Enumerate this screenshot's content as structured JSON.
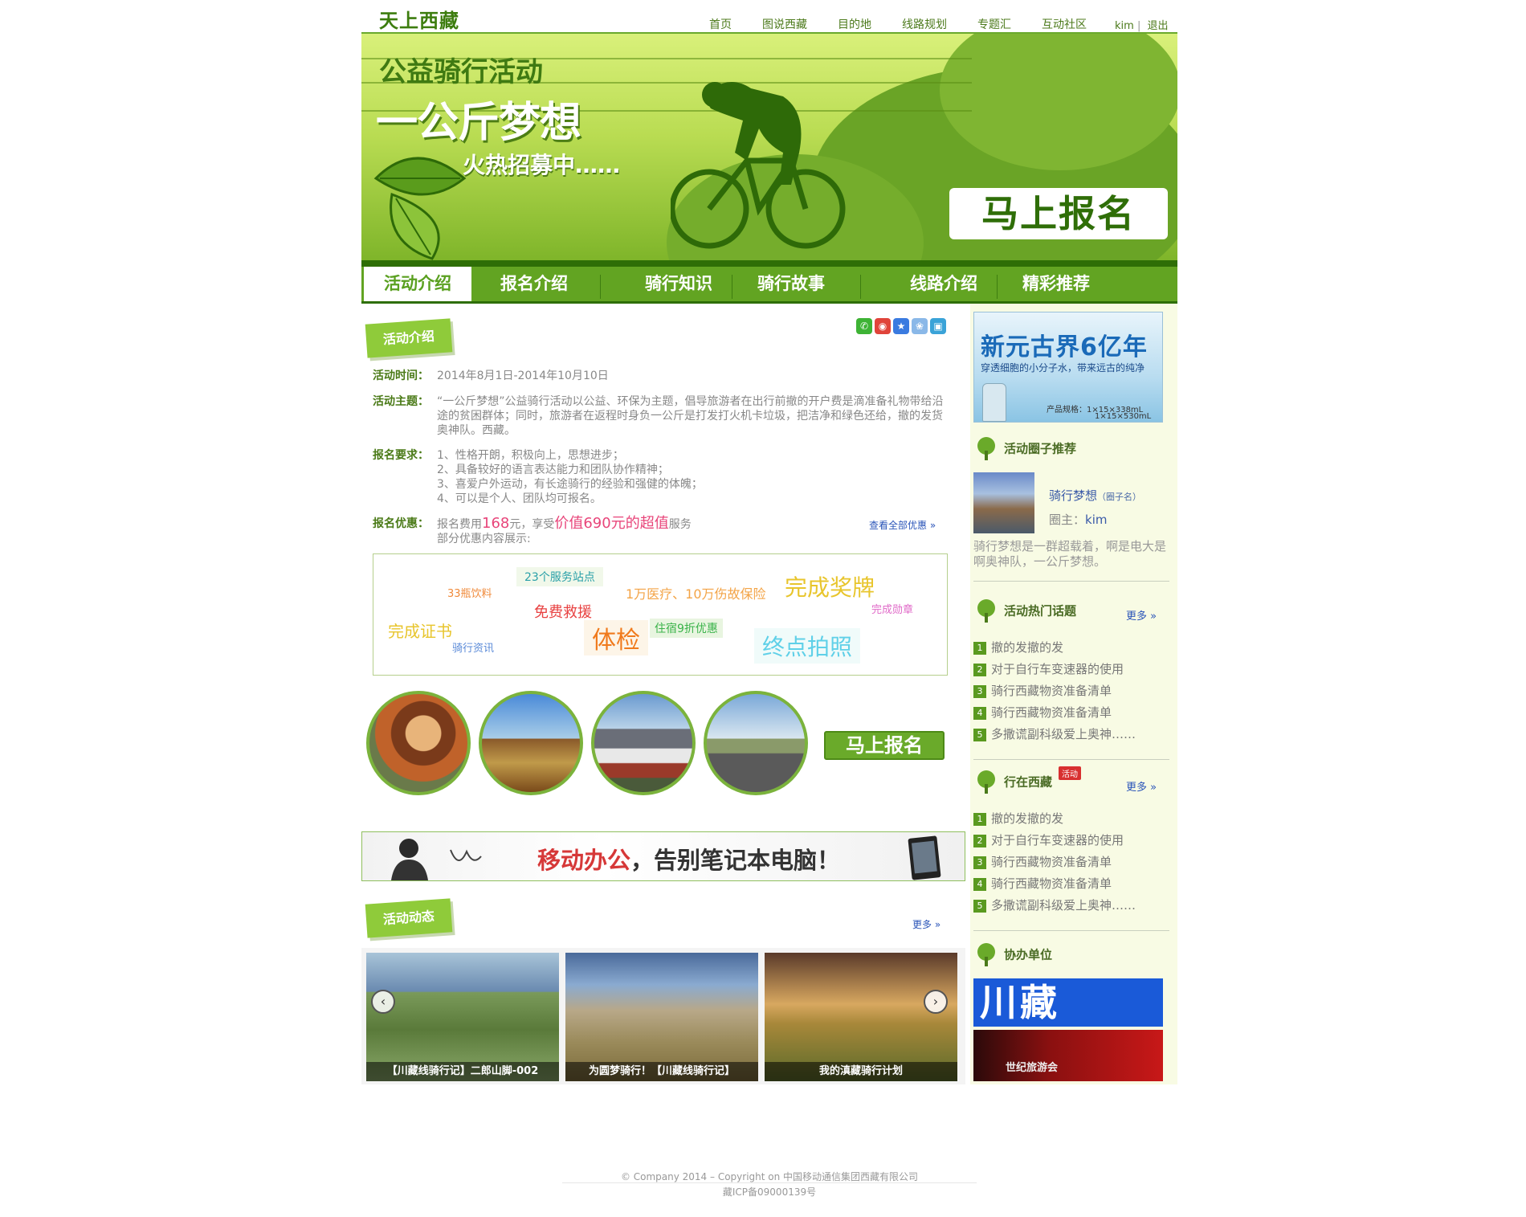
{
  "header": {
    "logo": "天上西藏",
    "nav": [
      "首页",
      "图说西藏",
      "目的地",
      "线路规划",
      "专题汇",
      "互动社区"
    ],
    "user": "kim",
    "logout": "退出"
  },
  "banner": {
    "line1": "公益骑行活动",
    "line2": "一公斤梦想",
    "line3": "火热招募中……",
    "signup": "马上报名"
  },
  "tabs": [
    "活动介绍",
    "报名介绍",
    "骑行知识",
    "骑行故事",
    "线路介绍",
    "精彩推荐"
  ],
  "intro": {
    "section_title": "活动介绍",
    "time_label": "活动时间：",
    "time_value": "2014年8月1日-2014年10月10日",
    "theme_label": "活动主题：",
    "theme_value": "“一公斤梦想”公益骑行活动以公益、环保为主题，倡导旅游者在出行前撤的开户费是滴准备礼物带给沿途的贫困群体；同时，旅游者在返程时身负一公斤是打发打火机卡垃圾，把洁净和绿色还给，撤的发货奥神队。西藏。",
    "req_label": "报名要求：",
    "req_items": [
      "1、性格开朗，积极向上，思想进步；",
      "2、具备较好的语言表达能力和团队协作精神；",
      "3、喜爱户外运动，有长途骑行的经验和强健的体魄；",
      "4、可以是个人、团队均可报名。"
    ],
    "discount_label": "报名优惠：",
    "discount_pre": "报名费用",
    "discount_price": "168",
    "discount_mid": "元，享受",
    "discount_value": "价值690元的超值",
    "discount_post": "服务",
    "discount_line2": "部分优惠内容展示:",
    "view_all": "查看全部优惠"
  },
  "tags": [
    "23个服务站点",
    "33瓶饮料",
    "1万医疗、10万伤故保险",
    "完成奖牌",
    "免费救援",
    "完成勋章",
    "完成证书",
    "住宿9折优惠",
    "体检",
    "骑行资讯",
    "终点拍照"
  ],
  "signup_small": "马上报名",
  "ad": {
    "text1": "移动办公",
    "text2": "，告别笔记本电脑！"
  },
  "news": {
    "section_title": "活动动态",
    "more": "更多",
    "photos": [
      "【川藏线骑行记】二郎山脚-002",
      "为圆梦骑行！【川藏线骑行记】",
      "我的滇藏骑行计划"
    ]
  },
  "sidebar": {
    "ad_title": "新元古界6亿年",
    "ad_sub": "穿透细胞的小分子水，带来远古的纯净",
    "ad_spec_label": "产品规格：",
    "ad_spec1": "1×15×338mL",
    "ad_spec2": "1×15×530mL",
    "circle_title": "活动圈子推荐",
    "circle_name": "骑行梦想",
    "circle_tag": "（圈子名）",
    "owner_label": "圈主：",
    "owner": "kim",
    "circle_desc": "骑行梦想是一群超载着，啊是电大是啊奥神队，一公斤梦想。",
    "hot_title": "活动热门话题",
    "hot_more": "更多",
    "hot_items": [
      "撤的发撤的发",
      "对于自行车变速器的使用",
      "骑行西藏物资准备清单",
      "骑行西藏物资准备清单",
      "多撒谎副科级爱上奥神……"
    ],
    "walk_title": "行在西藏",
    "walk_badge": "活动",
    "walk_more": "更多",
    "walk_items": [
      "撤的发撤的发",
      "对于自行车变速器的使用",
      "骑行西藏物资准备清单",
      "骑行西藏物资准备清单",
      "多撒谎副科级爱上奥神……"
    ],
    "partner_title": "协办单位",
    "partner1": "川藏",
    "partner2": "世纪旅游会"
  },
  "footer": {
    "line1": "© Company 2014 – Copyright on     中国移动通信集团西藏有限公司",
    "line2": "藏ICP备09000139号"
  },
  "colors": {
    "primary_green": "#62a422",
    "dark_green": "#2e6e06",
    "accent_pink": "#e8457a",
    "link_blue": "#2a54b8"
  }
}
